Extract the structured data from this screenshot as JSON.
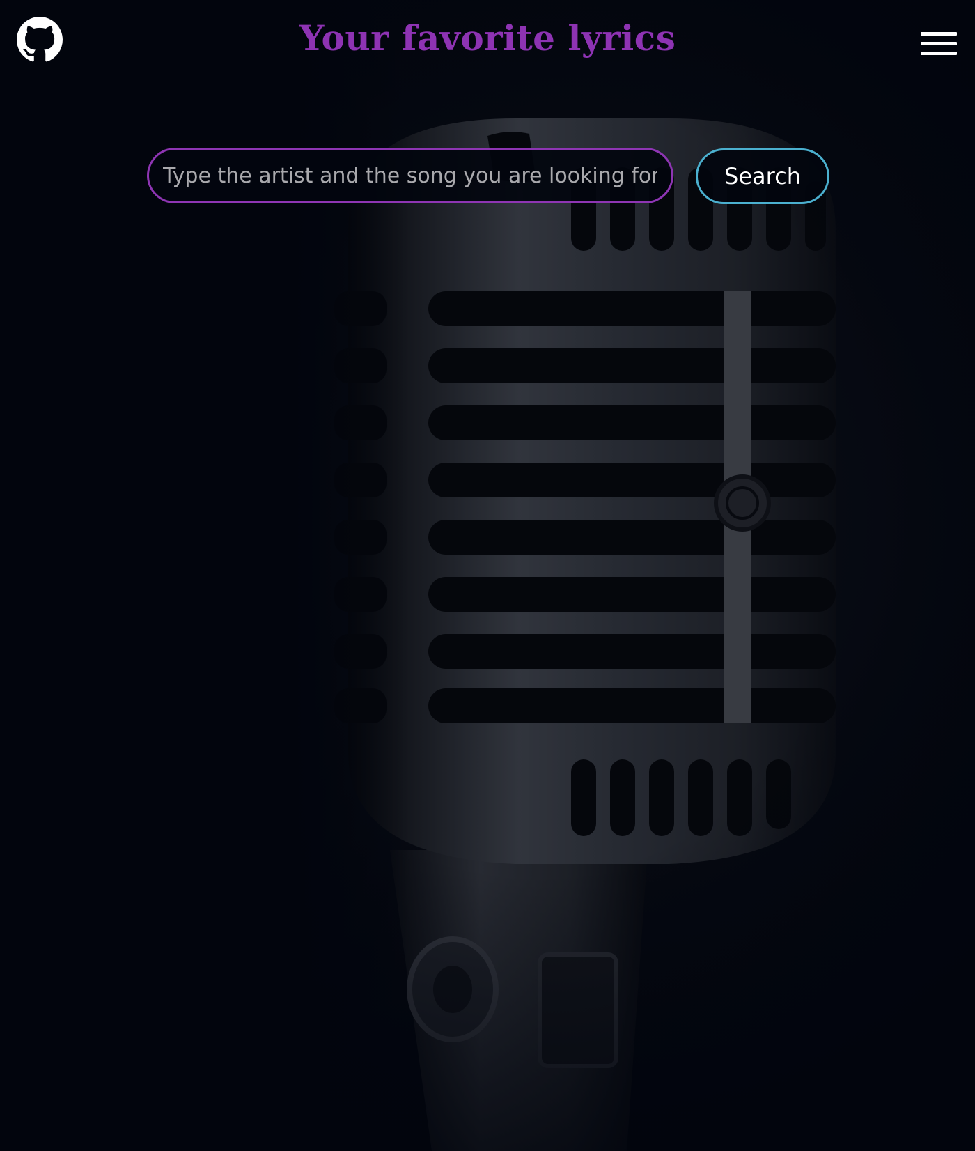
{
  "header": {
    "title": "Your favorite lyrics",
    "github_icon": "github-icon",
    "menu_icon": "hamburger-menu-icon"
  },
  "search": {
    "placeholder": "Type the artist and the song you are looking for",
    "value": "",
    "button_label": "Search"
  },
  "background": {
    "subject": "vintage-microphone"
  },
  "colors": {
    "title": "#8e33b3",
    "input_border": "#8e35b3",
    "button_border": "#4bb0cf",
    "background": "#02060f"
  }
}
